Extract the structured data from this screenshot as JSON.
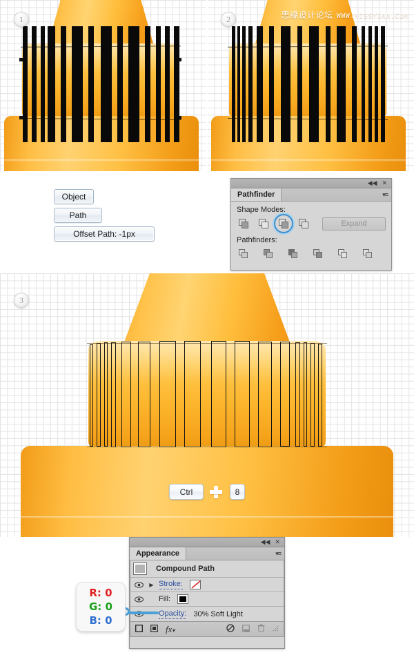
{
  "watermark": {
    "cn": "思缘设计论坛",
    "en": "WWW.MISSYUAN.COM"
  },
  "steps": [
    {
      "number": "1"
    },
    {
      "number": "2"
    },
    {
      "number": "3"
    }
  ],
  "menu_chain": {
    "object_label": "Object",
    "path_label": "Path",
    "offset_label": "Offset Path: -1px"
  },
  "shortcut": {
    "key1": "Ctrl",
    "plus": "+",
    "key2": "8"
  },
  "pathfinder_panel": {
    "tab": "Pathfinder",
    "collapse_icon": "◀◀",
    "close_icon": "✕",
    "menu_icon": "▾≡",
    "shape_modes_label": "Shape Modes:",
    "pathfinders_label": "Pathfinders:",
    "expand_label": "Expand",
    "shape_modes": [
      {
        "name": "unite",
        "selected": false
      },
      {
        "name": "minus-front",
        "selected": false
      },
      {
        "name": "intersect",
        "selected": true
      },
      {
        "name": "exclude",
        "selected": false
      }
    ],
    "pathfinders": [
      {
        "name": "divide"
      },
      {
        "name": "trim"
      },
      {
        "name": "merge"
      },
      {
        "name": "crop"
      },
      {
        "name": "outline"
      },
      {
        "name": "minus-back"
      }
    ]
  },
  "appearance_panel": {
    "tab": "Appearance",
    "collapse_icon": "◀◀",
    "close_icon": "✕",
    "menu_icon": "▾≡",
    "object_name": "Compound Path",
    "rows": [
      {
        "label": "Stroke:",
        "value": "",
        "swatch": "none"
      },
      {
        "label": "Fill:",
        "value": "",
        "swatch": "black"
      },
      {
        "label": "Opacity:",
        "value": "30% Soft Light",
        "swatch": ""
      }
    ],
    "footer_icons": [
      "new-stroke-icon",
      "new-fill-icon",
      "fx-icon",
      "clear-appearance-icon",
      "duplicate-item-icon",
      "delete-item-icon",
      "resize-grip-icon"
    ],
    "fx_label": "fx"
  },
  "rgb_callout": {
    "r_label": "R:",
    "r_value": "0",
    "g_label": "G:",
    "g_value": "0",
    "b_label": "B:",
    "b_value": "0"
  },
  "colors": {
    "orange_light": "#ffd472",
    "orange_mid": "#fcb52c",
    "orange_dark": "#ef8f10",
    "rib_black": "#09090a",
    "accent_blue": "#4a9fd8",
    "panel_gray": "#d6d6d6"
  }
}
